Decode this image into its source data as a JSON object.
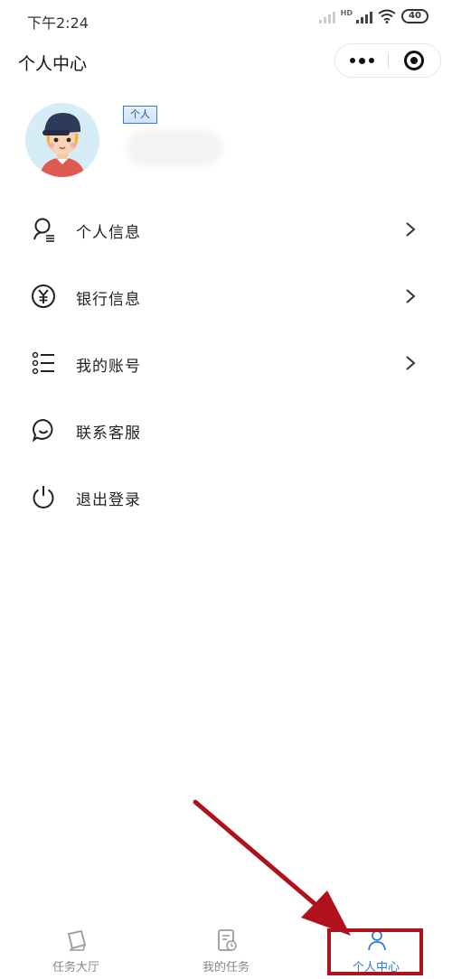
{
  "status_bar": {
    "time": "下午2:24",
    "hd_label": "HD",
    "battery": "40"
  },
  "header": {
    "title": "个人中心",
    "more_icon": "more-dots-icon",
    "close_icon": "target-circle-icon"
  },
  "profile": {
    "role_badge": "个人"
  },
  "menu": {
    "items": [
      {
        "label": "个人信息",
        "icon": "person-search-icon",
        "has_arrow": true
      },
      {
        "label": "银行信息",
        "icon": "yen-circle-icon",
        "has_arrow": true
      },
      {
        "label": "我的账号",
        "icon": "list-icon",
        "has_arrow": true
      },
      {
        "label": "联系客服",
        "icon": "chat-bubble-icon",
        "has_arrow": false
      },
      {
        "label": "退出登录",
        "icon": "power-icon",
        "has_arrow": false
      }
    ]
  },
  "tabbar": {
    "tabs": [
      {
        "label": "任务大厅",
        "icon": "task-hall-icon",
        "active": false
      },
      {
        "label": "我的任务",
        "icon": "my-task-icon",
        "active": false
      },
      {
        "label": "个人中心",
        "icon": "personal-center-icon",
        "active": true
      }
    ],
    "active_color": "#2f7bd6",
    "inactive_color": "#888888"
  },
  "annotation": {
    "arrow_color": "#b0121b",
    "box_color": "#b0121b"
  }
}
